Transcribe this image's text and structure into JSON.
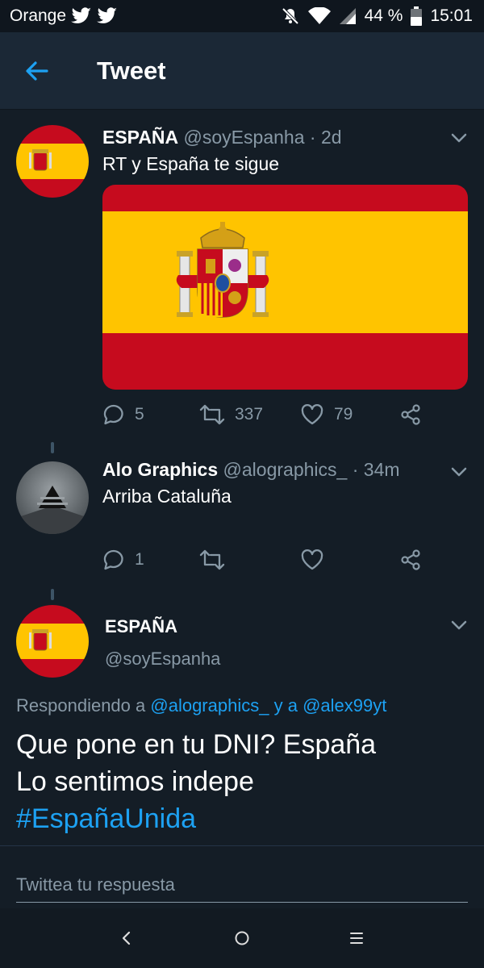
{
  "status_bar": {
    "carrier": "Orange",
    "battery": "44 %",
    "time": "15:01"
  },
  "app_bar": {
    "title": "Tweet"
  },
  "tweets": [
    {
      "name": "ESPAÑA",
      "handle": "@soyEspanha",
      "separator": "·",
      "time": "2d",
      "text": "RT y España te sigue",
      "replies": "5",
      "retweets": "337",
      "likes": "79"
    },
    {
      "name": "Alo Graphics",
      "handle": "@alographics_",
      "separator": "·",
      "time": "34m",
      "text": "Arriba Cataluña",
      "replies": "1"
    }
  ],
  "main_tweet": {
    "name": "ESPAÑA",
    "handle": "@soyEspanha",
    "replying_prefix": "Respondiendo a",
    "replying_user1": "@alographics_",
    "replying_conj": "y a",
    "replying_user2": "@alex99yt",
    "line1": "Que pone en tu DNI? España",
    "line2": "Lo sentimos indepe",
    "hashtag": "#EspañaUnida"
  },
  "compose": {
    "placeholder": "Twittea tu respuesta"
  },
  "colors": {
    "background": "#141d26",
    "accent": "#1da1f2",
    "muted": "#8899a6",
    "flag_red": "#c60b1e",
    "flag_yellow": "#ffc400"
  }
}
